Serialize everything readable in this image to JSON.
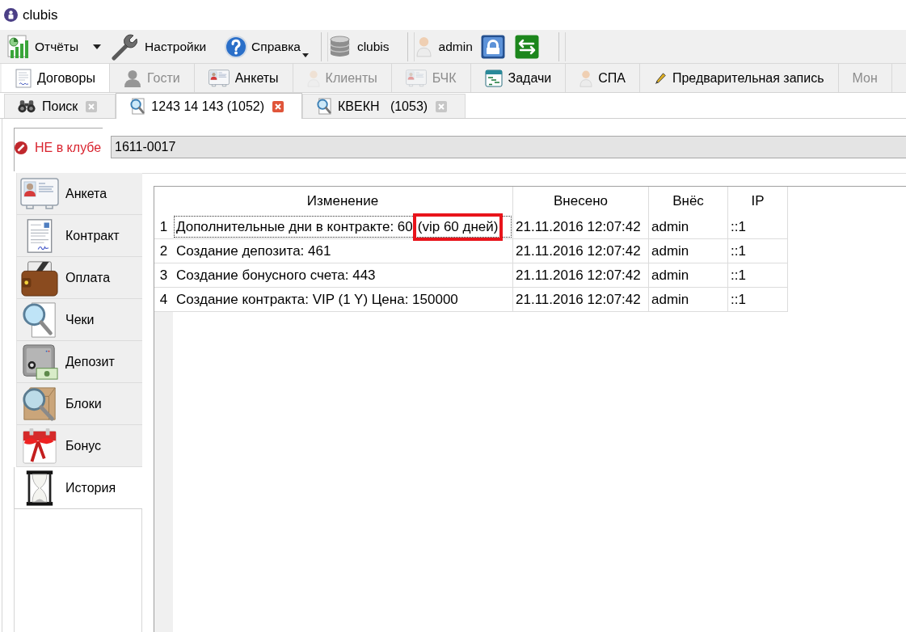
{
  "window": {
    "title": "clubis"
  },
  "toolbar": [
    {
      "kind": "split",
      "label": "Отчёты"
    },
    {
      "kind": "button",
      "label": "Настройки"
    },
    {
      "kind": "menu",
      "label": "Справка"
    },
    {
      "kind": "separator"
    },
    {
      "kind": "label",
      "label": "clubis"
    },
    {
      "kind": "separator"
    },
    {
      "kind": "label",
      "label": "admin"
    },
    {
      "kind": "icon_button"
    },
    {
      "kind": "icon_button"
    },
    {
      "kind": "separator"
    }
  ],
  "module_tabs": [
    {
      "label": "Договоры",
      "selected": true,
      "disabled": false
    },
    {
      "label": "Гости",
      "selected": false,
      "disabled": true
    },
    {
      "label": "Анкеты",
      "selected": false,
      "disabled": false
    },
    {
      "label": "Клиенты",
      "selected": false,
      "disabled": true
    },
    {
      "label": "БЧК",
      "selected": false,
      "disabled": true
    },
    {
      "label": "Задачи",
      "selected": false,
      "disabled": false
    },
    {
      "label": "СПА",
      "selected": false,
      "disabled": false
    },
    {
      "label": "Предварительная запись",
      "selected": false,
      "disabled": false
    },
    {
      "label": "Мон",
      "selected": false,
      "disabled": true
    }
  ],
  "document_tabs": [
    {
      "label": "Поиск",
      "selected": false
    },
    {
      "label": "1243 14 143 (1052)",
      "selected": true
    },
    {
      "label": "КВЕКН   (1053)",
      "selected": false
    }
  ],
  "membership": {
    "status": "НЕ в клубе",
    "card_number": "1611-0017"
  },
  "side_nav": [
    {
      "label": "Анкета",
      "selected": false
    },
    {
      "label": "Контракт",
      "selected": false
    },
    {
      "label": "Оплата",
      "selected": false
    },
    {
      "label": "Чеки",
      "selected": false
    },
    {
      "label": "Депозит",
      "selected": false
    },
    {
      "label": "Блоки",
      "selected": false
    },
    {
      "label": "Бонус",
      "selected": false
    },
    {
      "label": "История",
      "selected": true
    }
  ],
  "table": {
    "columns": [
      "Изменение",
      "Внесено",
      "Внёс",
      "IP"
    ],
    "rows": [
      {
        "number": "1",
        "change": "Дополнительные дни в контракте: 60",
        "highlight": "(vip 60 дней)",
        "date": "21.11.2016 12:07:42",
        "user": "admin",
        "ip": "::1",
        "focused": true
      },
      {
        "number": "2",
        "change": "Создание депозита: 461",
        "date": "21.11.2016 12:07:42",
        "user": "admin",
        "ip": "::1",
        "focused": false
      },
      {
        "number": "3",
        "change": "Создание бонусного счета: 443",
        "date": "21.11.2016 12:07:42",
        "user": "admin",
        "ip": "::1",
        "focused": false
      },
      {
        "number": "4",
        "change": "Создание контракта: VIP (1 Y) Цена: 150000",
        "date": "21.11.2016 12:07:42",
        "user": "admin",
        "ip": "::1",
        "focused": false
      }
    ]
  }
}
